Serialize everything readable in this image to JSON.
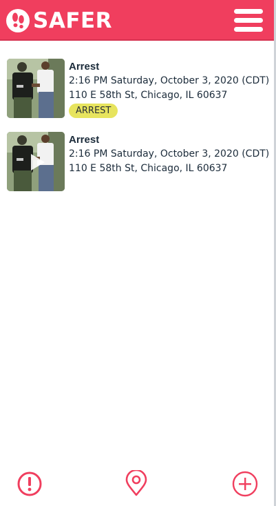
{
  "header": {
    "brand": "SAFER",
    "logo_icon": "footprints-icon",
    "menu_icon": "hamburger-menu-icon",
    "brand_color": "#f03e5e"
  },
  "reports": [
    {
      "title": "Arrest",
      "datetime": "2:16 PM Saturday, October 3, 2020 (CDT)",
      "address": "110 E 58th St, Chicago, IL 60637",
      "tag": "ARREST",
      "media": "photo",
      "tag_color": "#e7e45e"
    },
    {
      "title": "Arrest",
      "datetime": "2:16 PM Saturday, October 3, 2020 (CDT)",
      "address": "110 E 58th St, Chicago, IL 60637",
      "media": "video",
      "play_icon": "play-icon"
    }
  ],
  "bottom_nav": {
    "left_icon": "alert-icon",
    "center_icon": "map-pin-icon",
    "right_icon": "add-icon"
  }
}
